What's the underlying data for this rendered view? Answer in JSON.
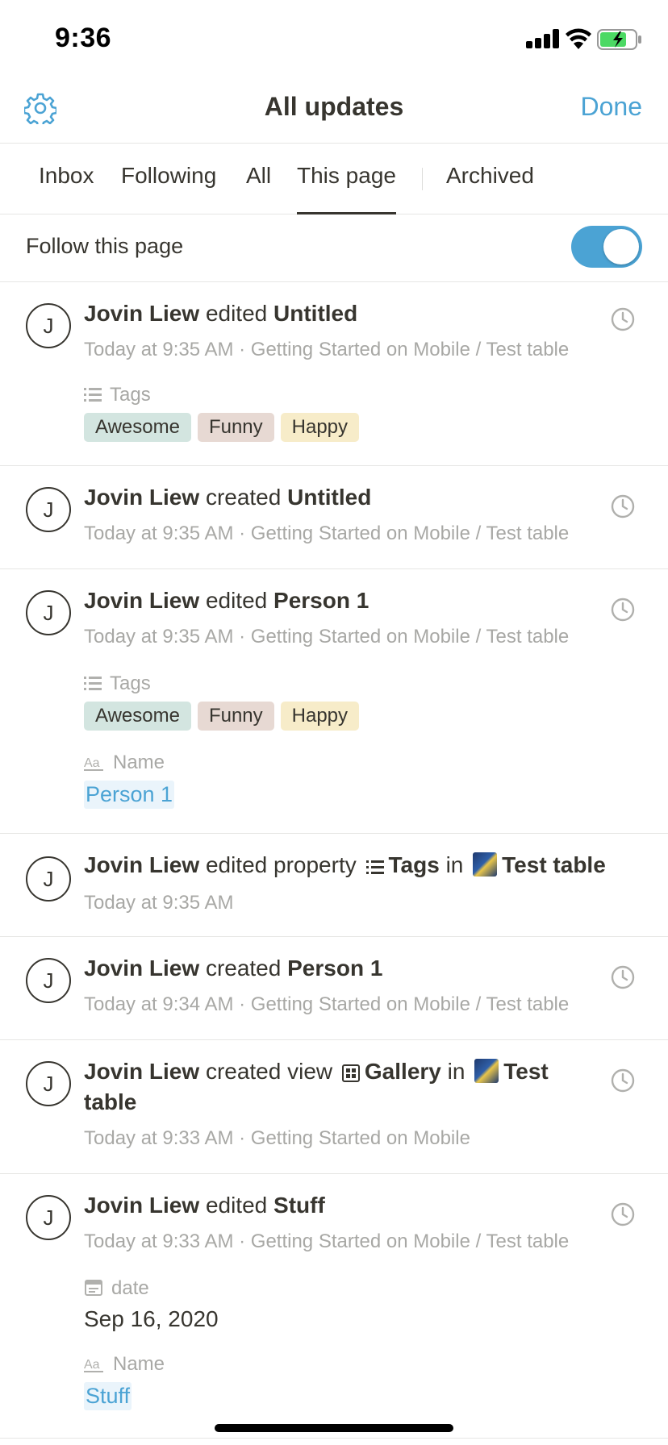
{
  "status_bar": {
    "time": "9:36"
  },
  "header": {
    "title": "All updates",
    "done_label": "Done"
  },
  "tabs": [
    {
      "label": "Inbox"
    },
    {
      "label": "Following"
    },
    {
      "label": "All"
    },
    {
      "label": "This page",
      "active": true
    },
    {
      "label": "Archived"
    }
  ],
  "follow": {
    "label": "Follow this page",
    "enabled": true
  },
  "colors": {
    "accent": "#4ba3d4",
    "tag_awesome": "#d3e5e0",
    "tag_funny": "#e7d9d3",
    "tag_happy": "#f7ecc9"
  },
  "entries": [
    {
      "avatar": "J",
      "user": "Jovin Liew",
      "action": "edited",
      "target": "Untitled",
      "meta": "Today at 9:35 AM · Getting Started on Mobile / Test table",
      "tags_label": "Tags",
      "tags": [
        "Awesome",
        "Funny",
        "Happy"
      ]
    },
    {
      "avatar": "J",
      "user": "Jovin Liew",
      "action": "created",
      "target": "Untitled",
      "meta": "Today at 9:35 AM · Getting Started on Mobile / Test table"
    },
    {
      "avatar": "J",
      "user": "Jovin Liew",
      "action": "edited",
      "target": "Person 1",
      "meta": "Today at 9:35 AM · Getting Started on Mobile / Test table",
      "tags_label": "Tags",
      "tags": [
        "Awesome",
        "Funny",
        "Happy"
      ],
      "name_label": "Name",
      "name_value": "Person 1"
    },
    {
      "avatar": "J",
      "user": "Jovin Liew",
      "action": "edited property",
      "property": "Tags",
      "connector": "in",
      "target": "Test table",
      "meta": "Today at 9:35 AM"
    },
    {
      "avatar": "J",
      "user": "Jovin Liew",
      "action": "created",
      "target": "Person 1",
      "meta": "Today at 9:34 AM · Getting Started on Mobile / Test table"
    },
    {
      "avatar": "J",
      "user": "Jovin Liew",
      "action": "created view",
      "view": "Gallery",
      "connector": "in",
      "target": "Test table",
      "meta": "Today at 9:33 AM · Getting Started on Mobile"
    },
    {
      "avatar": "J",
      "user": "Jovin Liew",
      "action": "edited",
      "target": "Stuff",
      "meta": "Today at 9:33 AM · Getting Started on Mobile / Test table",
      "date_label": "date",
      "date_value": "Sep 16, 2020",
      "name_label": "Name",
      "name_value": "Stuff"
    }
  ]
}
